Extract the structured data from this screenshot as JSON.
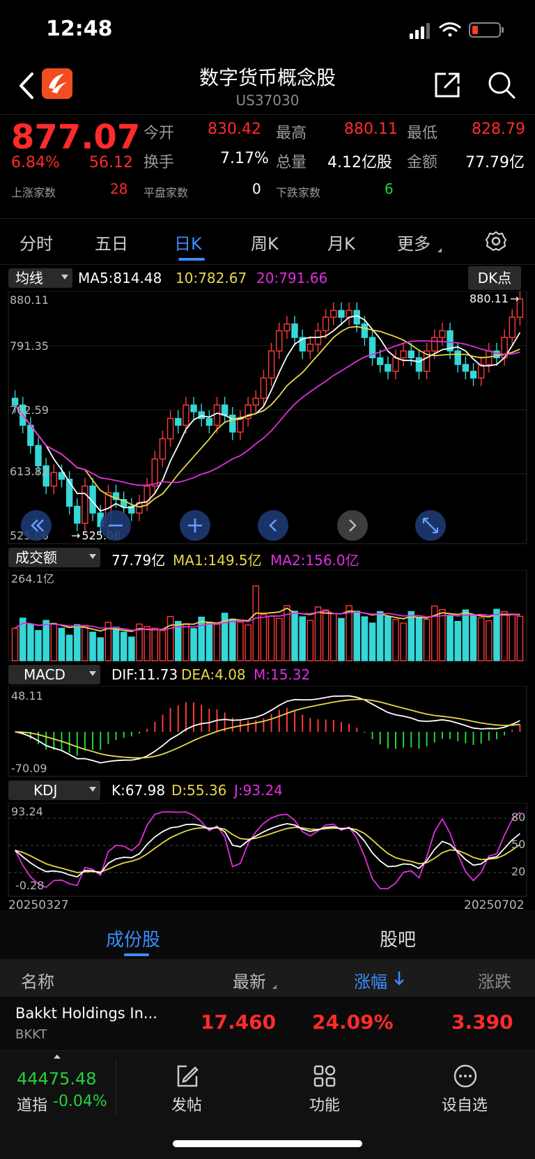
{
  "status": {
    "time": "12:48"
  },
  "nav": {
    "title": "数字货币概念股",
    "code": "US37030"
  },
  "quote": {
    "price": "877.07",
    "change_pct": "6.84%",
    "change_abs": "56.12",
    "up_label": "上涨家数",
    "up_count": "28",
    "flat_label": "平盘家数",
    "flat_count": "0",
    "down_label": "下跌家数",
    "down_count": "6",
    "open_label": "今开",
    "open": "830.42",
    "high_label": "最高",
    "high": "880.11",
    "low_label": "最低",
    "low": "828.79",
    "turnover_label": "换手",
    "turnover": "7.17%",
    "volume_label": "总量",
    "volume": "4.12亿股",
    "amount_label": "金额",
    "amount": "77.79亿"
  },
  "tabs": [
    "分时",
    "五日",
    "日K",
    "周K",
    "月K",
    "更多"
  ],
  "active_tab": "日K",
  "kline": {
    "ma_select": "均线",
    "ma5": "MA5:814.48",
    "ma10": "10:782.67",
    "ma20": "20:791.66",
    "dk_button": "DK点",
    "y_labels": [
      "880.11",
      "791.35",
      "702.59",
      "613.82",
      "525.06"
    ],
    "high_marker": "880.11",
    "low_marker": "525.06"
  },
  "volume_panel": {
    "select": "成交额",
    "value": "77.79亿",
    "ma1": "MA1:149.5亿",
    "ma2": "MA2:156.0亿",
    "max_label": "264.1亿"
  },
  "macd_panel": {
    "select": "MACD",
    "dif": "DIF:11.73",
    "dea": "DEA:4.08",
    "m": "M:15.32",
    "top_label": "48.11",
    "bottom_label": "-70.09"
  },
  "kdj_panel": {
    "select": "KDJ",
    "k": "K:67.98",
    "d": "D:55.36",
    "j": "J:93.24",
    "top_label": "93.24",
    "bottom_label": "-0.28",
    "levels": [
      "80",
      "50",
      "20"
    ],
    "date_start": "20250327",
    "date_end": "20250702"
  },
  "subtabs": [
    "成份股",
    "股吧"
  ],
  "list_header": {
    "name": "名称",
    "latest": "最新",
    "pct": "涨幅",
    "chg": "涨跌"
  },
  "list_rows": [
    {
      "name": "Bakkt Holdings In...",
      "code": "BKKT",
      "latest": "17.460",
      "pct": "24.09%",
      "chg": "3.390"
    }
  ],
  "bottom": {
    "index_value": "44475.48",
    "index_name": "道指",
    "index_pct": "-0.04%",
    "post_label": "发帖",
    "func_label": "功能",
    "watch_label": "设自选"
  },
  "colors": {
    "up": "#ff2b2b",
    "down": "#22d43a",
    "accent": "#3b8cff",
    "ma5": "#ffffff",
    "ma10": "#e8d848",
    "ma20": "#e02fe0"
  }
}
